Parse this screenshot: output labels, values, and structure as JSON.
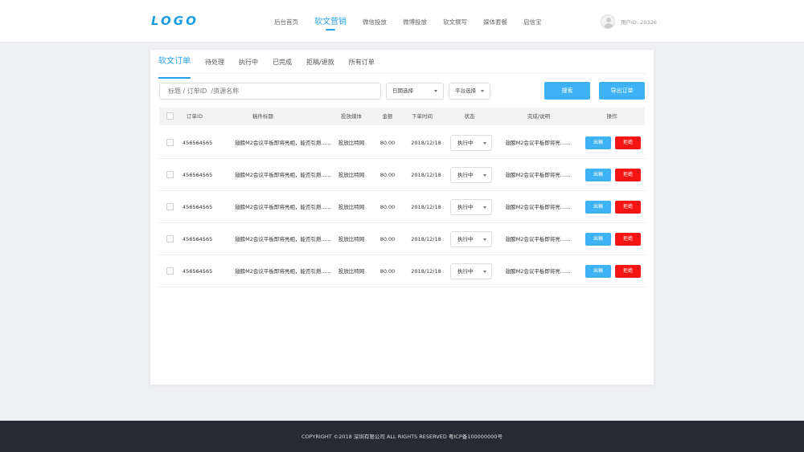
{
  "header": {
    "logo": "LOGO",
    "nav": [
      {
        "label": "后台首页",
        "active": false
      },
      {
        "label": "软文营销",
        "active": true
      },
      {
        "label": "微信投放",
        "active": false
      },
      {
        "label": "微博投放",
        "active": false
      },
      {
        "label": "软文撰写",
        "active": false
      },
      {
        "label": "媒体套餐",
        "active": false
      },
      {
        "label": "启信宝",
        "active": false
      }
    ],
    "user_id": "用户ID: 20326"
  },
  "tabs": [
    "软文订单",
    "待处理",
    "执行中",
    "已完成",
    "拒稿/退款",
    "所有订单"
  ],
  "filters": {
    "search_placeholder": "标题 / 订单ID  /资源名称",
    "date_select": "日期选择",
    "platform_select": "平台选择",
    "search_button": "搜索",
    "export_button": "导出订单"
  },
  "table": {
    "headers": [
      "订单ID",
      "稿件标题",
      "投放媒体",
      "金额",
      "下单时间",
      "状态",
      "完成/说明",
      "操作"
    ],
    "rows": [
      {
        "id": "456564565",
        "title": "翅膀M2会议平板即将亮相，能否引燃......",
        "media": "投放比特网",
        "amount": "80.00",
        "date": "2018/12/18",
        "status": "执行中",
        "note": "翅膀M2会议平板即将亮......",
        "out_label": "出稿",
        "reject_label": "拒绝"
      },
      {
        "id": "456564565",
        "title": "翅膀M2会议平板即将亮相，能否引燃......",
        "media": "投放比特网",
        "amount": "80.00",
        "date": "2018/12/18",
        "status": "执行中",
        "note": "翅膀M2会议平板即将亮......",
        "out_label": "出稿",
        "reject_label": "拒绝"
      },
      {
        "id": "456564565",
        "title": "翅膀M2会议平板即将亮相，能否引燃......",
        "media": "投放比特网",
        "amount": "80.00",
        "date": "2018/12/18",
        "status": "执行中",
        "note": "翅膀M2会议平板即将亮......",
        "out_label": "出稿",
        "reject_label": "拒绝"
      },
      {
        "id": "456564565",
        "title": "翅膀M2会议平板即将亮相，能否引燃......",
        "media": "投放比特网",
        "amount": "80.00",
        "date": "2018/12/18",
        "status": "执行中",
        "note": "翅膀M2会议平板即将亮......",
        "out_label": "出稿",
        "reject_label": "拒绝"
      },
      {
        "id": "456564565",
        "title": "翅膀M2会议平板即将亮相，能否引燃......",
        "media": "投放比特网",
        "amount": "80.00",
        "date": "2018/12/18",
        "status": "执行中",
        "note": "翅膀M2会议平板即将亮......",
        "out_label": "出稿",
        "reject_label": "拒绝"
      }
    ]
  },
  "footer": "COPYRIGHT ©2018 深圳有限公司 ALL RIGHTS RESERVED 粤ICP备100000000号",
  "colors": {
    "accent": "#27a2e8",
    "button_blue": "#3eb2f2",
    "reject_red": "#f51515",
    "footer_bg": "#282a33"
  }
}
